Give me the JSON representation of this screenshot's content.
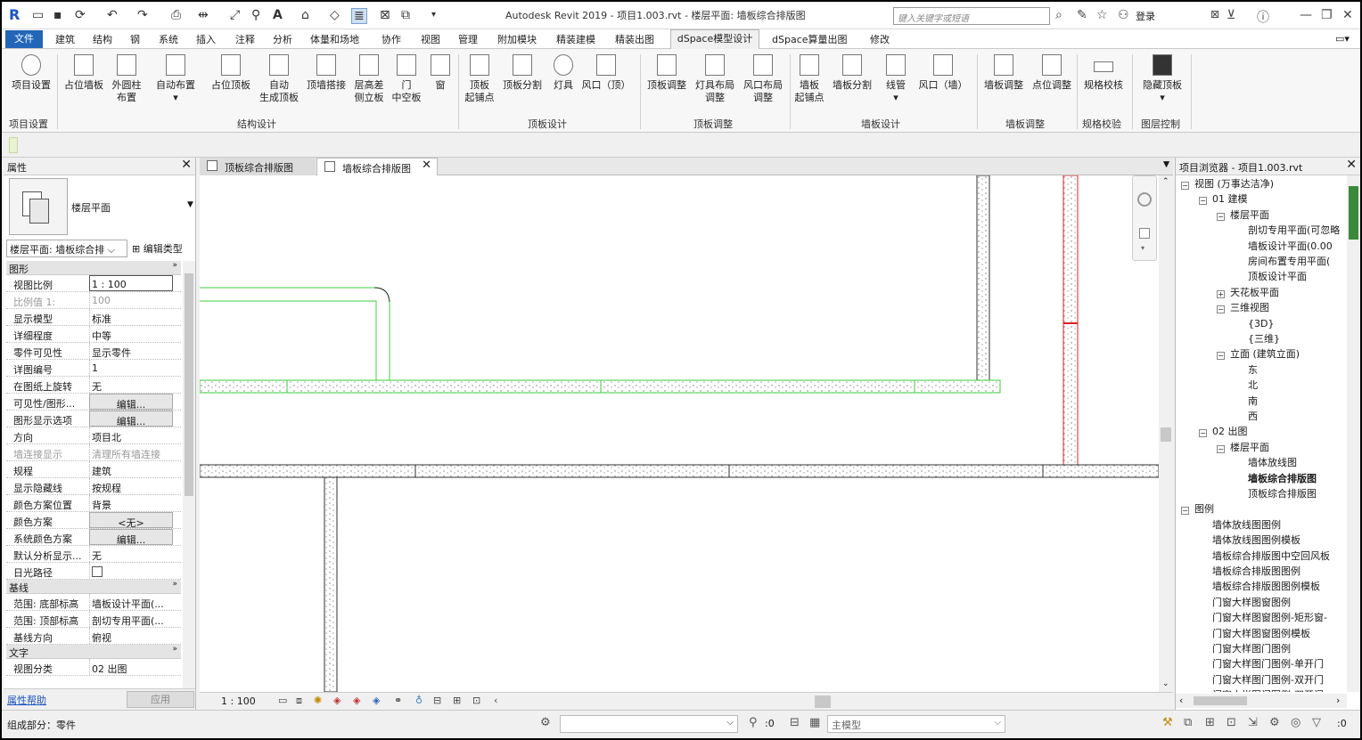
{
  "app": {
    "title": "Autodesk Revit 2019 - 项目1.003.rvt - 楼层平面: 墙板综合排版图",
    "search_placeholder": "键入关键字或短语",
    "login": "登录"
  },
  "menu_tabs": [
    "文件",
    "建筑",
    "结构",
    "钢",
    "系统",
    "插入",
    "注释",
    "分析",
    "体量和场地",
    "协作",
    "视图",
    "管理",
    "附加模块",
    "精装建模",
    "精装出图",
    "dSpace模型设计",
    "dSpace算量出图",
    "修改"
  ],
  "ribbon": {
    "buttons": [
      {
        "label": "项目设置"
      },
      {
        "label": "占位墙板"
      },
      {
        "label": "外圆柱\n布置"
      },
      {
        "label": "自动布置\n▾"
      },
      {
        "label": "占位顶板"
      },
      {
        "label": "自动\n生成顶板"
      },
      {
        "label": "顶墙搭接"
      },
      {
        "label": "层高差\n侧立板"
      },
      {
        "label": "门\n中空板"
      },
      {
        "label": "窗"
      },
      {
        "label": "顶板\n起铺点"
      },
      {
        "label": "顶板分割"
      },
      {
        "label": "灯具"
      },
      {
        "label": "风口（顶）"
      },
      {
        "label": "顶板调整"
      },
      {
        "label": "灯具布局\n调整"
      },
      {
        "label": "风口布局\n调整"
      },
      {
        "label": "墙板\n起铺点"
      },
      {
        "label": "墙板分割"
      },
      {
        "label": "线管\n▾"
      },
      {
        "label": "风口（墙）"
      },
      {
        "label": "墙板调整"
      },
      {
        "label": "点位调整"
      },
      {
        "label": "规格校核"
      },
      {
        "label": "隐藏顶板\n▾"
      }
    ],
    "groups": [
      "项目设置",
      "结构设计",
      "顶板设计",
      "顶板调整",
      "墙板设计",
      "墙板调整",
      "规格校验",
      "图层控制"
    ]
  },
  "properties": {
    "title": "属性",
    "type_name": "楼层平面",
    "view_selector": "楼层平面: 墙板综合排",
    "edit_type": "编辑类型",
    "sections": [
      {
        "name": "图形",
        "rows": [
          {
            "k": "视图比例",
            "v": "1 : 100",
            "style": "box"
          },
          {
            "k": "比例值 1:",
            "v": "100",
            "style": "gray"
          },
          {
            "k": "显示模型",
            "v": "标准"
          },
          {
            "k": "详细程度",
            "v": "中等"
          },
          {
            "k": "零件可见性",
            "v": "显示零件"
          },
          {
            "k": "详图编号",
            "v": "1"
          },
          {
            "k": "在图纸上旋转",
            "v": "无"
          },
          {
            "k": "可见性/图形...",
            "v": "编辑...",
            "style": "btn"
          },
          {
            "k": "图形显示选项",
            "v": "编辑...",
            "style": "btn"
          },
          {
            "k": "方向",
            "v": "项目北"
          },
          {
            "k": "墙连接显示",
            "v": "清理所有墙连接",
            "style": "gray"
          },
          {
            "k": "规程",
            "v": "建筑"
          },
          {
            "k": "显示隐藏线",
            "v": "按规程"
          },
          {
            "k": "颜色方案位置",
            "v": "背景"
          },
          {
            "k": "颜色方案",
            "v": "<无>",
            "style": "btn"
          },
          {
            "k": "系统颜色方案",
            "v": "编辑...",
            "style": "btn"
          },
          {
            "k": "默认分析显示...",
            "v": "无"
          },
          {
            "k": "日光路径",
            "v": "",
            "style": "chk"
          }
        ]
      },
      {
        "name": "基线",
        "rows": [
          {
            "k": "范围: 底部标高",
            "v": "墙板设计平面(..."
          },
          {
            "k": "范围: 顶部标高",
            "v": "剖切专用平面(..."
          },
          {
            "k": "基线方向",
            "v": "俯视"
          }
        ]
      },
      {
        "name": "文字",
        "rows": [
          {
            "k": "视图分类",
            "v": "02 出图"
          }
        ]
      }
    ],
    "help_link": "属性帮助",
    "apply": "应用"
  },
  "view_tabs": [
    {
      "label": "顶板综合排版图"
    },
    {
      "label": "墙板综合排版图"
    }
  ],
  "view_scale": "1 : 100",
  "browser": {
    "title": "项目浏览器 - 项目1.003.rvt",
    "items": [
      {
        "label": "视图 (万事达洁净)",
        "level": 0,
        "toggle": "−"
      },
      {
        "label": "01 建模",
        "level": 1,
        "toggle": "−"
      },
      {
        "label": "楼层平面",
        "level": 2,
        "toggle": "−"
      },
      {
        "label": "剖切专用平面(可忽略",
        "level": 3
      },
      {
        "label": "墙板设计平面(0.00",
        "level": 3
      },
      {
        "label": "房间布置专用平面(",
        "level": 3
      },
      {
        "label": "顶板设计平面",
        "level": 3
      },
      {
        "label": "天花板平面",
        "level": 2,
        "toggle": "+"
      },
      {
        "label": "三维视图",
        "level": 2,
        "toggle": "−"
      },
      {
        "label": "{3D}",
        "level": 3
      },
      {
        "label": "{三维}",
        "level": 3
      },
      {
        "label": "立面 (建筑立面)",
        "level": 2,
        "toggle": "−"
      },
      {
        "label": "东",
        "level": 3
      },
      {
        "label": "北",
        "level": 3
      },
      {
        "label": "南",
        "level": 3
      },
      {
        "label": "西",
        "level": 3
      },
      {
        "label": "02 出图",
        "level": 1,
        "toggle": "−"
      },
      {
        "label": "楼层平面",
        "level": 2,
        "toggle": "−"
      },
      {
        "label": "墙体放线图",
        "level": 3
      },
      {
        "label": "墙板综合排版图",
        "level": 3,
        "selected": true
      },
      {
        "label": "顶板综合排版图",
        "level": 3
      },
      {
        "label": "图例",
        "level": 0,
        "toggle": "−"
      },
      {
        "label": "墙体放线图图例",
        "level": 1
      },
      {
        "label": "墙体放线图图例模板",
        "level": 1
      },
      {
        "label": "墙板综合排版图中空回风板",
        "level": 1
      },
      {
        "label": "墙板综合排版图图例",
        "level": 1
      },
      {
        "label": "墙板综合排版图图例模板",
        "level": 1
      },
      {
        "label": "门窗大样图窗图例",
        "level": 1
      },
      {
        "label": "门窗大样图窗图例-矩形窗-",
        "level": 1
      },
      {
        "label": "门窗大样图窗图例模板",
        "level": 1
      },
      {
        "label": "门窗大样图门图例",
        "level": 1
      },
      {
        "label": "门窗大样图门图例-单开门",
        "level": 1
      },
      {
        "label": "门窗大样图门图例-双开门",
        "level": 1
      },
      {
        "label": "门窗大样图门图例-双开门",
        "level": 1
      }
    ]
  },
  "status": {
    "text": "组成部分：零件",
    "zero": ":0",
    "main_model": "主模型",
    "filter": ":0"
  }
}
